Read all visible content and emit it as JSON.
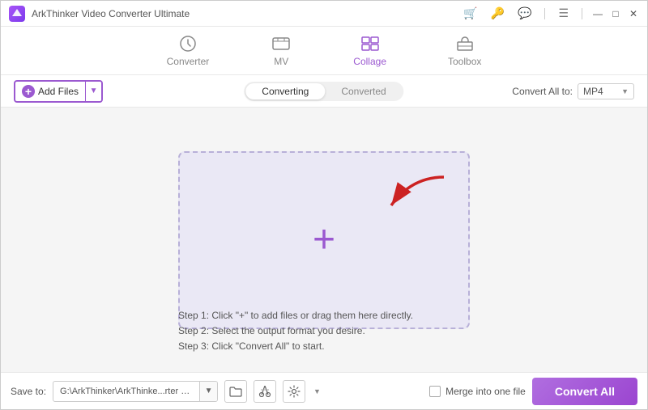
{
  "app": {
    "title": "ArkThinker Video Converter Ultimate",
    "logo": "A"
  },
  "titlebar": {
    "icons": [
      "cart-icon",
      "key-icon",
      "chat-icon",
      "menu-icon"
    ],
    "win_controls": [
      "minimize",
      "maximize",
      "close"
    ]
  },
  "nav": {
    "tabs": [
      {
        "id": "converter",
        "label": "Converter",
        "icon": "🔄"
      },
      {
        "id": "mv",
        "label": "MV",
        "icon": "🖼"
      },
      {
        "id": "collage",
        "label": "Collage",
        "icon": "⊞"
      },
      {
        "id": "toolbox",
        "label": "Toolbox",
        "icon": "🧰"
      }
    ],
    "active": "collage"
  },
  "toolbar": {
    "add_files_label": "Add Files",
    "tab_converting": "Converting",
    "tab_converted": "Converted",
    "active_tab": "converting",
    "convert_all_to_label": "Convert All to:",
    "format_value": "MP4"
  },
  "dropzone": {
    "plus": "+",
    "instructions": [
      "Step 1: Click \"+\" to add files or drag them here directly.",
      "Step 2: Select the output format you desire.",
      "Step 3: Click \"Convert All\" to start."
    ]
  },
  "bottom": {
    "save_to_label": "Save to:",
    "save_path": "G:\\ArkThinker\\ArkThinke...rter Ultimate\\Converted",
    "merge_label": "Merge into one file",
    "convert_all_label": "Convert All"
  }
}
